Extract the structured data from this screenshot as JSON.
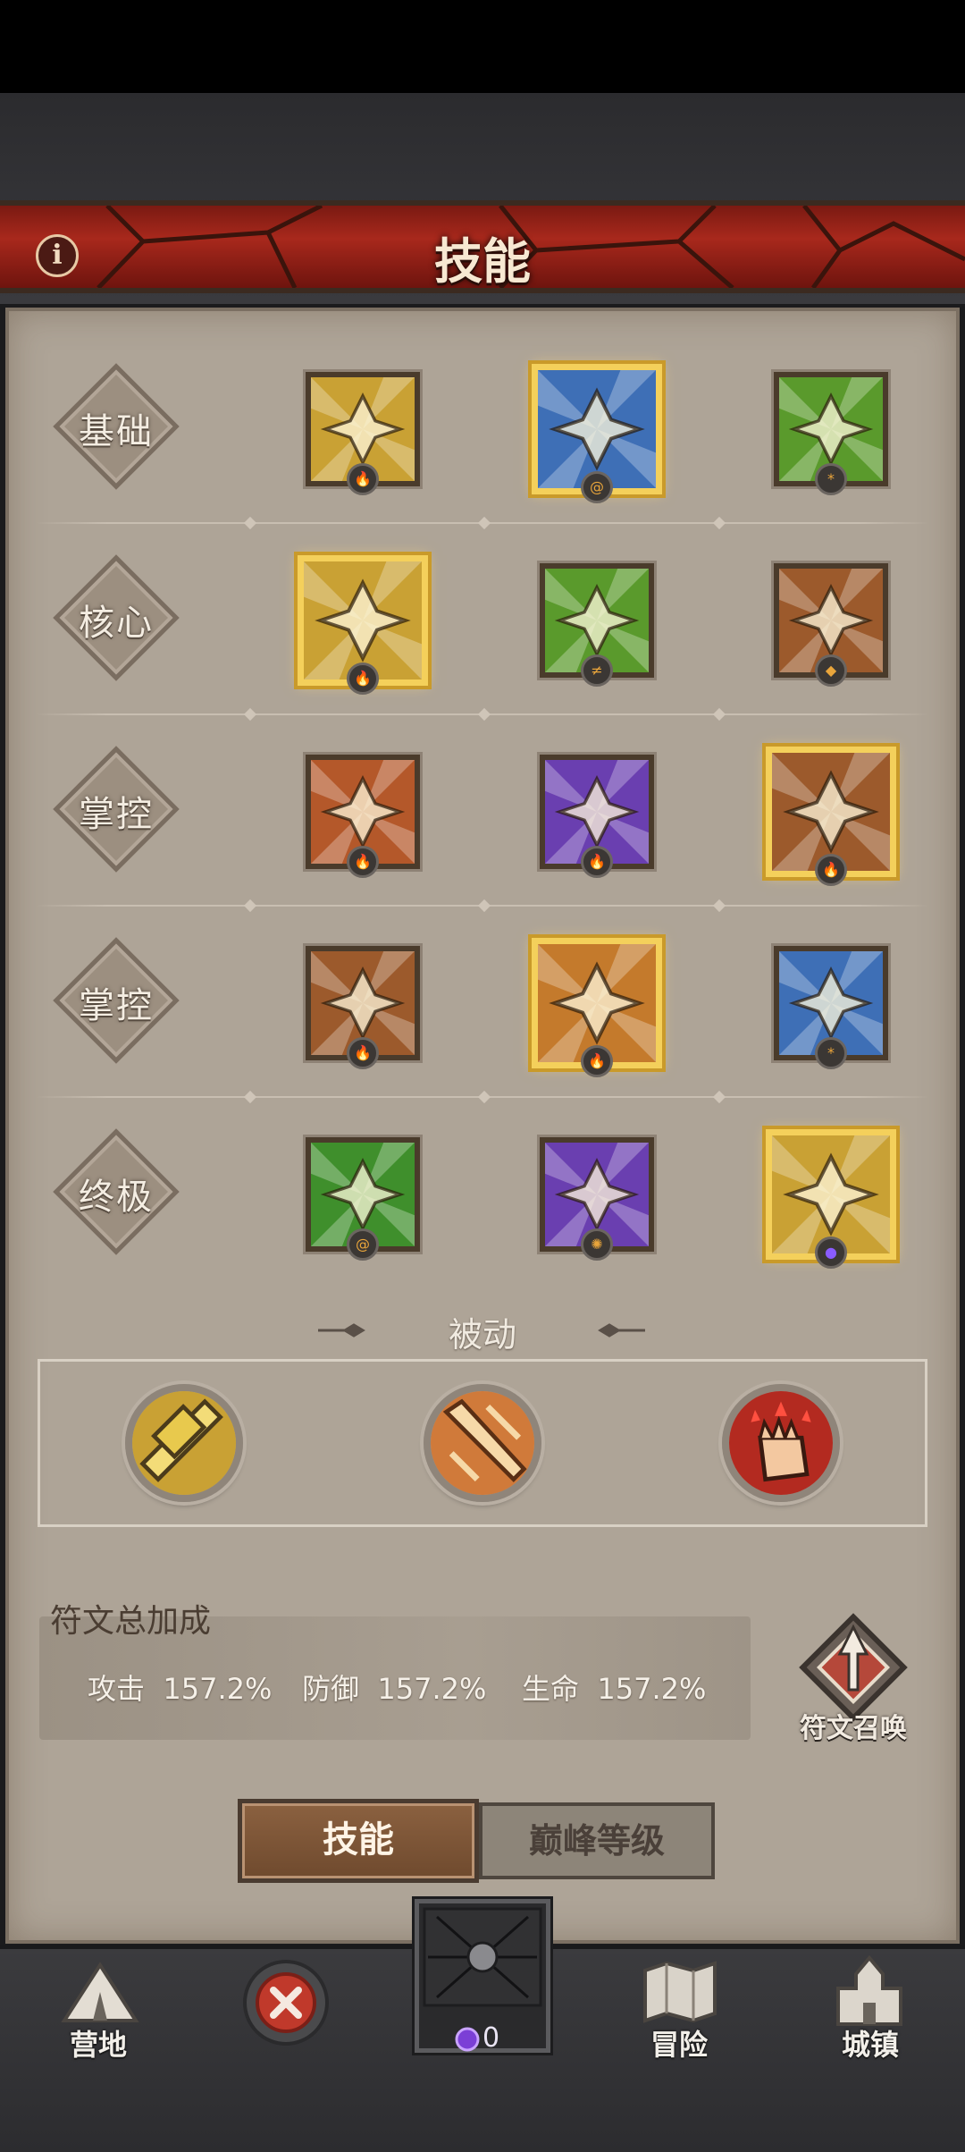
{
  "header": {
    "title": "技能",
    "info_icon": "i"
  },
  "rows": [
    {
      "label": "基础",
      "skills": [
        {
          "icon": "golden-axe-icon",
          "bg": "#c9a134",
          "selected": false,
          "badge": "fire"
        },
        {
          "icon": "ice-shard-icon",
          "bg": "#3e6fb6",
          "selected": true,
          "badge": "swirl"
        },
        {
          "icon": "green-strike-icon",
          "bg": "#5a9a2c",
          "selected": false,
          "badge": "spark"
        }
      ]
    },
    {
      "label": "核心",
      "skills": [
        {
          "icon": "whirlwind-icon",
          "bg": "#c9a134",
          "selected": true,
          "badge": "fire"
        },
        {
          "icon": "green-burst-icon",
          "bg": "#5a9a2c",
          "selected": false,
          "badge": "bolt"
        },
        {
          "icon": "totem-icon",
          "bg": "#9c5a2c",
          "selected": false,
          "badge": "shield"
        }
      ]
    },
    {
      "label": "掌控",
      "skills": [
        {
          "icon": "fireball-icon",
          "bg": "#b4582a",
          "selected": false,
          "badge": "fire"
        },
        {
          "icon": "purple-blast-icon",
          "bg": "#6a3fb0",
          "selected": false,
          "badge": "fire"
        },
        {
          "icon": "earth-slam-icon",
          "bg": "#9c5a2c",
          "selected": true,
          "badge": "fire"
        }
      ]
    },
    {
      "label": "掌控",
      "skills": [
        {
          "icon": "fist-icon",
          "bg": "#9c5a2c",
          "selected": false,
          "badge": "fire"
        },
        {
          "icon": "roar-icon",
          "bg": "#c47a2c",
          "selected": true,
          "badge": "fire"
        },
        {
          "icon": "ice-roar-icon",
          "bg": "#3e6fb6",
          "selected": false,
          "badge": "spark"
        }
      ]
    },
    {
      "label": "终极",
      "skills": [
        {
          "icon": "wind-arrow-icon",
          "bg": "#3f8f2c",
          "selected": false,
          "badge": "swirl"
        },
        {
          "icon": "demon-icon",
          "bg": "#6a3fb0",
          "selected": false,
          "badge": "gear"
        },
        {
          "icon": "golden-rage-icon",
          "bg": "#c9a134",
          "selected": true,
          "badge": "purple"
        }
      ]
    }
  ],
  "passive": {
    "title": "被动",
    "items": [
      {
        "icon": "golden-hammer-icon",
        "bg": "#c9a134"
      },
      {
        "icon": "blade-icon",
        "bg": "#d07a3a"
      },
      {
        "icon": "blood-fist-icon",
        "bg": "#b32a20"
      }
    ]
  },
  "rune_bonus": {
    "title": "符文总加成",
    "stats": [
      {
        "label": "攻击",
        "value": "157.2%"
      },
      {
        "label": "防御",
        "value": "157.2%"
      },
      {
        "label": "生命",
        "value": "157.2%"
      }
    ],
    "summon_label": "符文召唤"
  },
  "tabs": {
    "skill": "技能",
    "peak_level": "巅峰等级"
  },
  "nav": {
    "camp": "营地",
    "adventure": "冒险",
    "town": "城镇",
    "gem_count": "0"
  }
}
